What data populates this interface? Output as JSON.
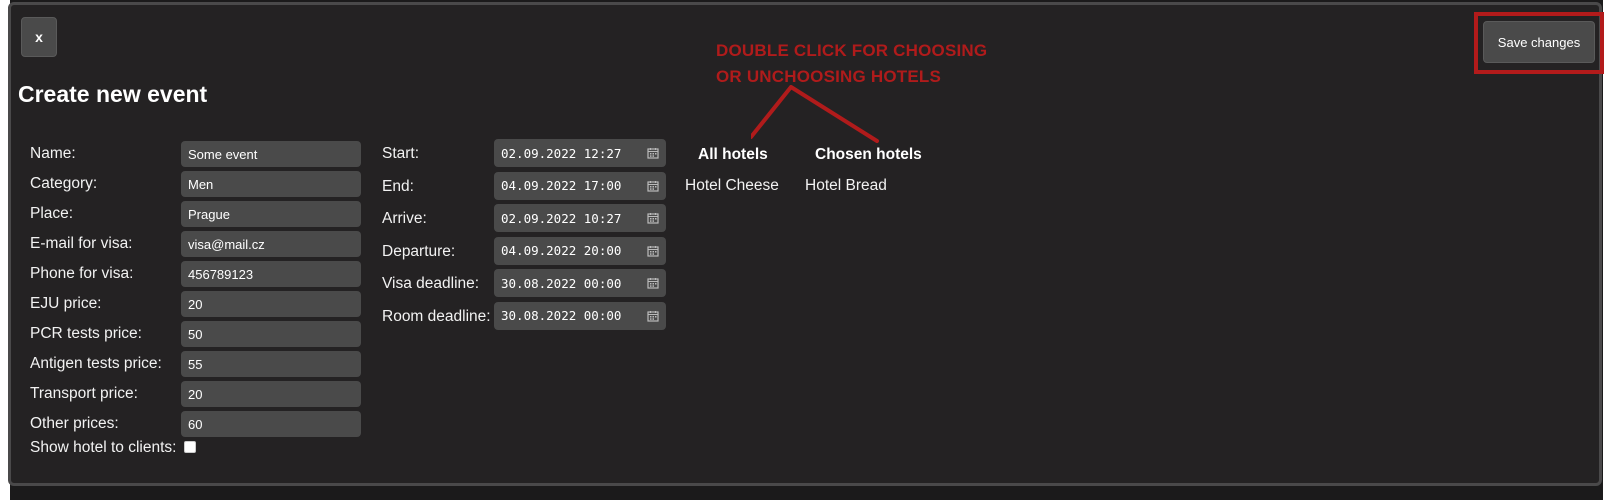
{
  "modal": {
    "close_label": "x",
    "save_label": "Save changes",
    "title": "Create new event",
    "hint_lines": [
      "DOUBLE CLICK FOR CHOOSING",
      "OR UNCHOOSING HOTELS"
    ]
  },
  "colors": {
    "accent_red": "#b01b1b",
    "panel": "#242223",
    "input": "#4a4a4a"
  },
  "left_form": [
    {
      "label": "Name:",
      "value": "Some event"
    },
    {
      "label": "Category:",
      "value": "Men"
    },
    {
      "label": "Place:",
      "value": "Prague"
    },
    {
      "label": "E-mail for visa:",
      "value": "visa@mail.cz"
    },
    {
      "label": "Phone for visa:",
      "value": "456789123"
    },
    {
      "label": "EJU price:",
      "value": "20"
    },
    {
      "label": "PCR tests price:",
      "value": "50"
    },
    {
      "label": "Antigen tests price:",
      "value": "55"
    },
    {
      "label": "Transport price:",
      "value": "20"
    },
    {
      "label": "Other prices:",
      "value": "60"
    }
  ],
  "show_hotel": {
    "label": "Show hotel to clients:",
    "checked": false
  },
  "date_form": [
    {
      "label": "Start:",
      "value": "02.09.2022 12:27"
    },
    {
      "label": "End:",
      "value": "04.09.2022 17:00"
    },
    {
      "label": "Arrive:",
      "value": "02.09.2022 10:27"
    },
    {
      "label": "Departure:",
      "value": "04.09.2022 20:00"
    },
    {
      "label": "Visa deadline:",
      "value": "30.08.2022 00:00"
    },
    {
      "label": "Room deadline:",
      "value": "30.08.2022 00:00"
    }
  ],
  "hotels": {
    "all_title": "All hotels",
    "chosen_title": "Chosen hotels",
    "all": [
      "Hotel Cheese"
    ],
    "chosen": [
      "Hotel Bread"
    ]
  }
}
